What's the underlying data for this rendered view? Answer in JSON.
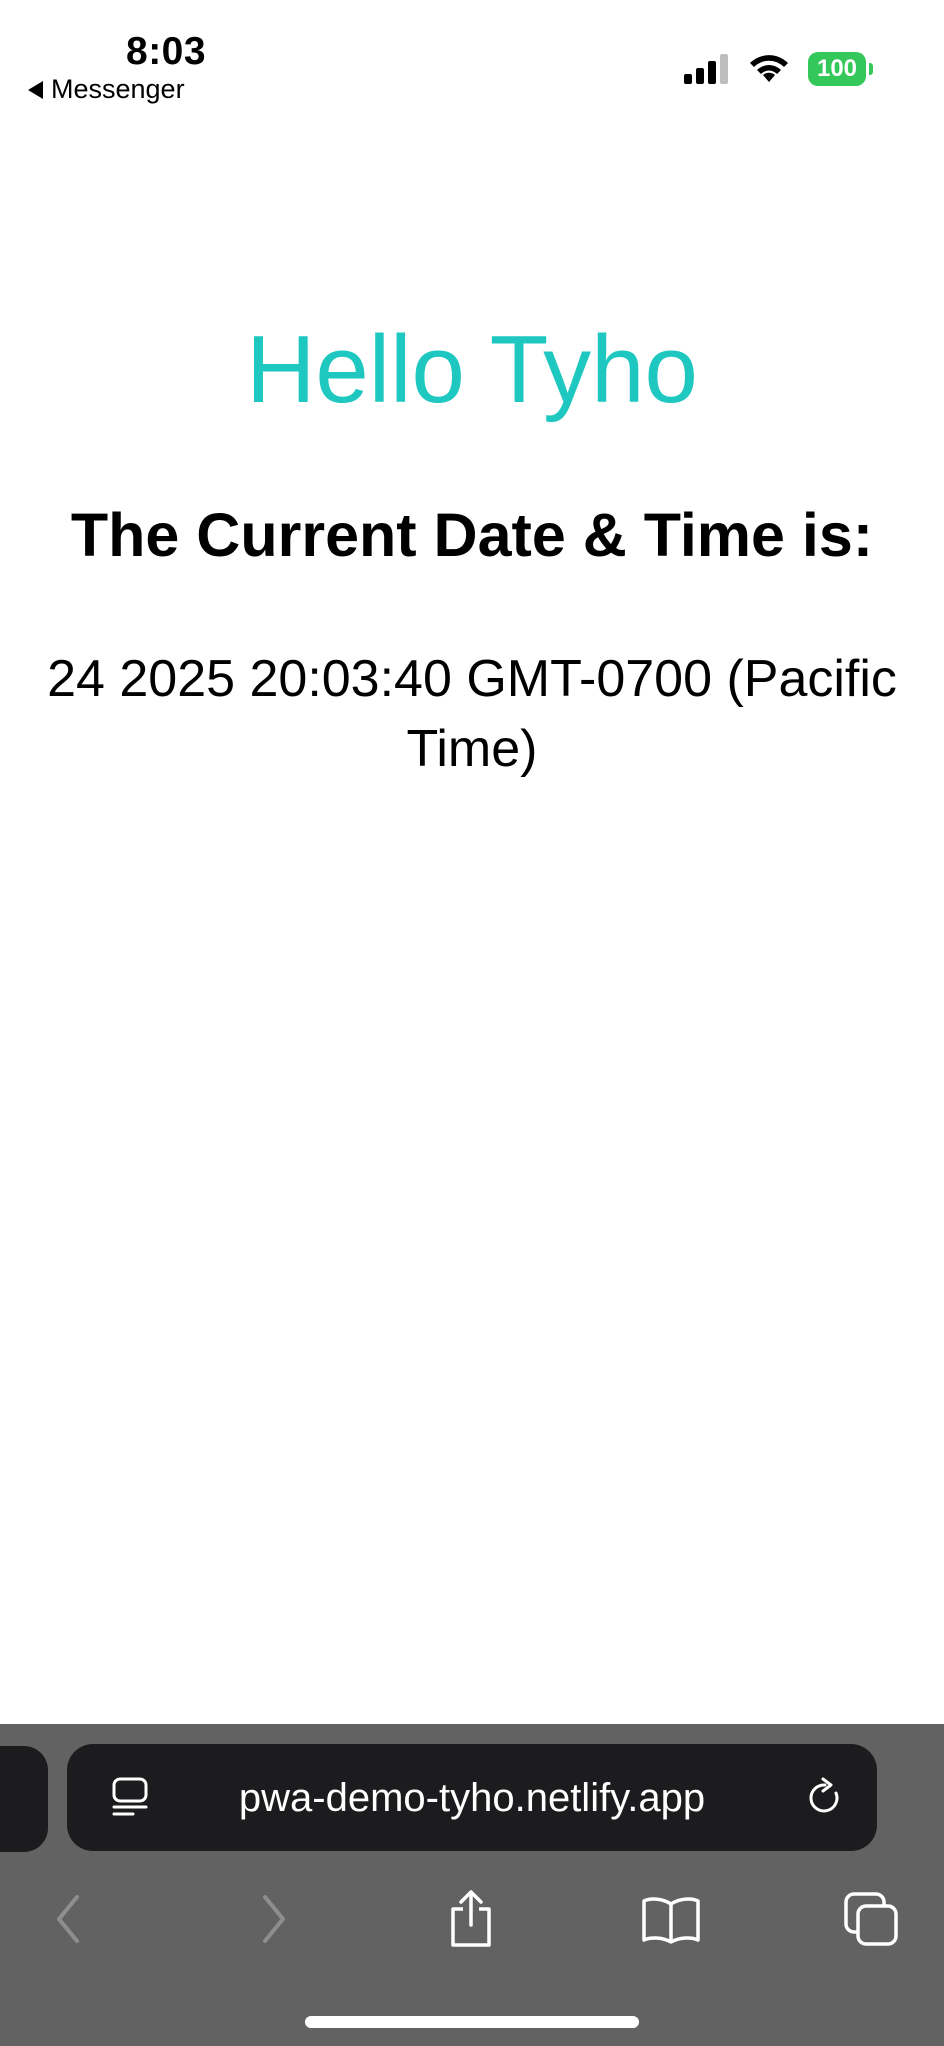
{
  "status_bar": {
    "time": "8:03",
    "back_app": "Messenger",
    "battery_level": "100"
  },
  "page": {
    "greeting": "Hello Tyho",
    "heading": "The Current Date & Time is:",
    "datetime": "24 2025 20:03:40 GMT-0700 (Pacific Time)"
  },
  "browser": {
    "url": "pwa-demo-tyho.netlify.app"
  },
  "icons": {
    "back": "back-arrow-icon",
    "signal": "cellular-signal-icon",
    "wifi": "wifi-icon",
    "battery": "battery-icon",
    "reader": "page-menu-icon",
    "reload": "reload-icon",
    "nav_back": "chevron-left-icon",
    "nav_forward": "chevron-right-icon",
    "share": "share-icon",
    "bookmarks": "bookmarks-icon",
    "tabs": "tabs-icon"
  },
  "colors": {
    "accent": "#1ec8c0",
    "battery": "#34c759",
    "toolbar_bg": "#626262",
    "url_bar_bg": "#1c1c1e"
  }
}
